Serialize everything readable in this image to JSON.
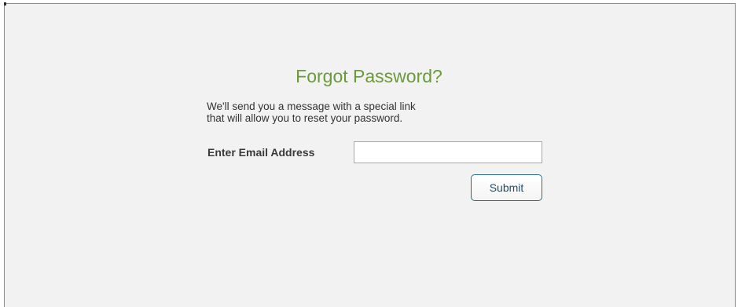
{
  "form": {
    "title": "Forgot Password?",
    "description_line1": "We'll send you a message with a special link",
    "description_line2": "that will allow you to reset your password.",
    "email_label": "Enter Email Address",
    "email_value": "",
    "email_placeholder": "",
    "submit_label": "Submit"
  },
  "colors": {
    "title": "#6a9a3a",
    "panel_background": "#f2f2f2",
    "button_border": "#2d6b86"
  }
}
